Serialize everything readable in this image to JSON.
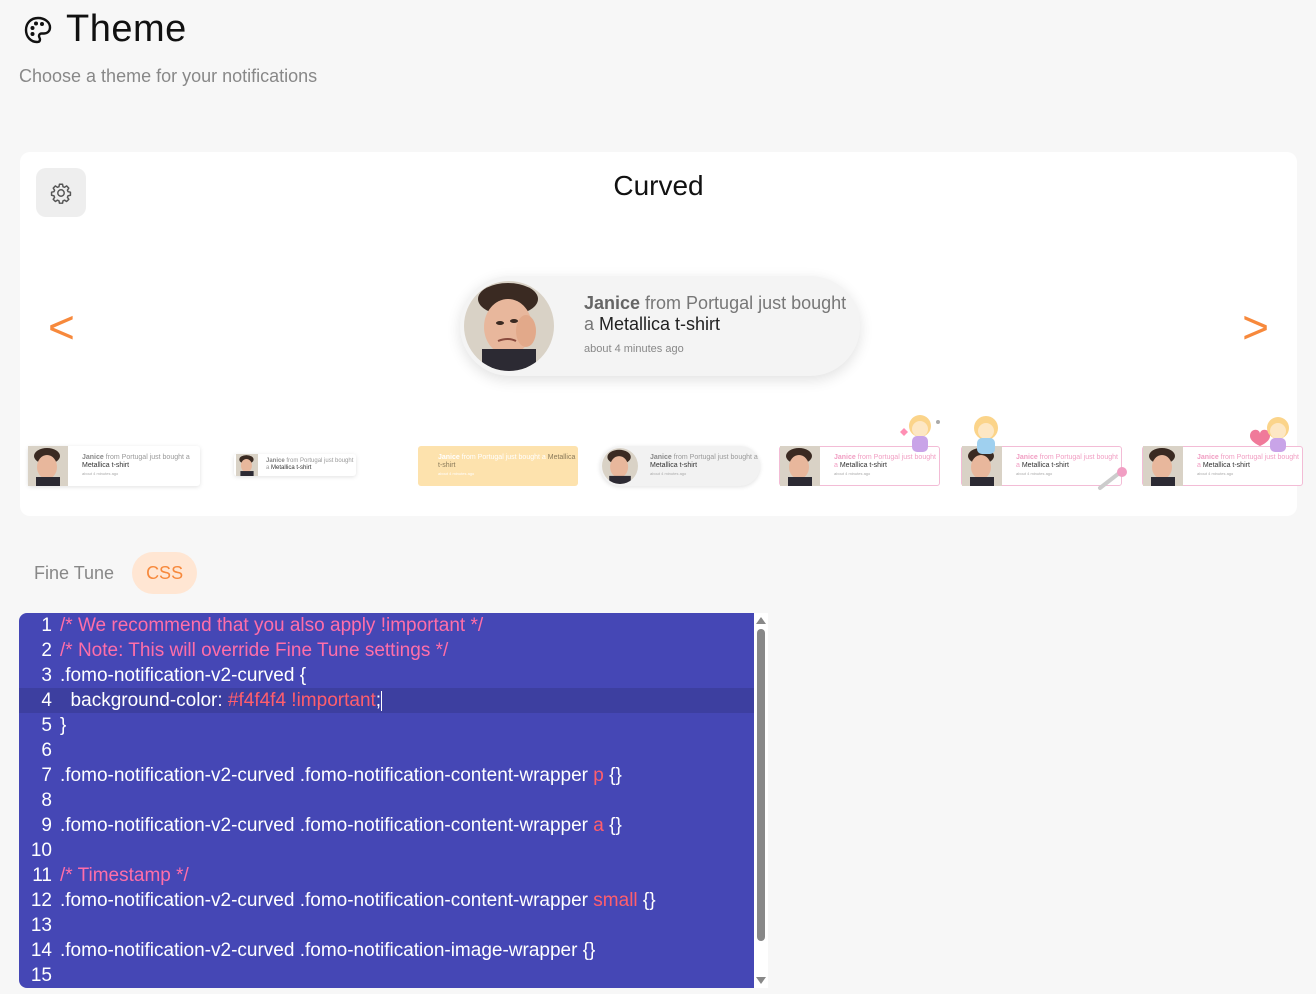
{
  "header": {
    "title": "Theme",
    "subtitle": "Choose a theme for your notifications"
  },
  "card": {
    "theme_name": "Curved",
    "prev_label": "<",
    "next_label": ">",
    "preview": {
      "name": "Janice",
      "from_text": " from Portugal just bought a ",
      "product": "Metallica t-shirt",
      "time": "about 4 minutes ago"
    },
    "thumb_text": {
      "name": "Janice",
      "from_text": " from Portugal just bought a ",
      "product": "Metallica t-shirt",
      "time": "about 4 minutes ago"
    }
  },
  "tabs": [
    {
      "label": "Fine Tune",
      "active": false
    },
    {
      "label": "CSS",
      "active": true
    }
  ],
  "editor": {
    "lines": [
      {
        "n": "1",
        "parts": [
          [
            "cm",
            "/* We recommend that you also apply !important */"
          ]
        ]
      },
      {
        "n": "2",
        "parts": [
          [
            "cm",
            "/* Note: This will override Fine Tune settings */"
          ]
        ]
      },
      {
        "n": "3",
        "parts": [
          [
            "sel",
            ".fomo-notification-v2-curved {"
          ]
        ]
      },
      {
        "n": "4",
        "parts": [
          [
            "sel",
            "  background-color: "
          ],
          [
            "val",
            "#f4f4f4 !important"
          ],
          [
            "sel",
            ";"
          ]
        ],
        "current": true
      },
      {
        "n": "5",
        "parts": [
          [
            "sel",
            "}"
          ]
        ]
      },
      {
        "n": "6",
        "parts": []
      },
      {
        "n": "7",
        "parts": [
          [
            "sel",
            ".fomo-notification-v2-curved .fomo-notification-content-wrapper "
          ],
          [
            "tag",
            "p"
          ],
          [
            "sel",
            " {}"
          ]
        ]
      },
      {
        "n": "8",
        "parts": []
      },
      {
        "n": "9",
        "parts": [
          [
            "sel",
            ".fomo-notification-v2-curved .fomo-notification-content-wrapper "
          ],
          [
            "tag",
            "a"
          ],
          [
            "sel",
            " {}"
          ]
        ]
      },
      {
        "n": "10",
        "parts": []
      },
      {
        "n": "11",
        "parts": [
          [
            "cm",
            "/* Timestamp */"
          ]
        ]
      },
      {
        "n": "12",
        "parts": [
          [
            "sel",
            ".fomo-notification-v2-curved .fomo-notification-content-wrapper "
          ],
          [
            "tag",
            "small"
          ],
          [
            "sel",
            " {}"
          ]
        ]
      },
      {
        "n": "13",
        "parts": []
      },
      {
        "n": "14",
        "parts": [
          [
            "sel",
            ".fomo-notification-v2-curved .fomo-notification-image-wrapper {}"
          ]
        ]
      },
      {
        "n": "15",
        "parts": []
      }
    ]
  },
  "colors": {
    "accent": "#f7893c",
    "editor_bg": "#4547b5",
    "comment": "#ff6ea9",
    "value": "#ff5e6c"
  }
}
